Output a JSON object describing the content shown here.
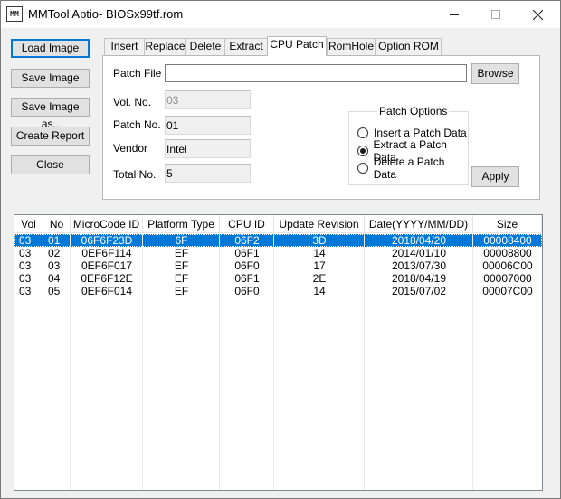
{
  "window": {
    "title": "MMTool Aptio- BIOSx99tf.rom",
    "icon_text": "MM"
  },
  "sidebar": {
    "load_image": "Load Image",
    "save_image": "Save Image",
    "save_image_as": "Save Image as..",
    "create_report": "Create Report",
    "close": "Close"
  },
  "tabs": [
    "Insert",
    "Replace",
    "Delete",
    "Extract",
    "CPU Patch",
    "RomHole",
    "Option ROM"
  ],
  "active_tab": "CPU Patch",
  "panel": {
    "patch_file_label": "Patch File",
    "patch_file_value": "",
    "browse": "Browse",
    "vol_no_label": "Vol. No.",
    "vol_no_value": "03",
    "patch_no_label": "Patch No.",
    "patch_no_value": "01",
    "vendor_label": "Vendor",
    "vendor_value": "Intel",
    "total_no_label": "Total No.",
    "total_no_value": "5",
    "patch_options_title": "Patch Options",
    "options": [
      {
        "label": "Insert a Patch Data",
        "selected": false
      },
      {
        "label": "Extract a Patch Data",
        "selected": true
      },
      {
        "label": "Delete a Patch Data",
        "selected": false
      }
    ],
    "apply": "Apply"
  },
  "table": {
    "columns": [
      "Vol",
      "No",
      "MicroCode ID",
      "Platform Type",
      "CPU ID",
      "Update Revision",
      "Date(YYYY/MM/DD)",
      "Size"
    ],
    "rows": [
      [
        "03",
        "01",
        "06F6F23D",
        "6F",
        "06F2",
        "3D",
        "2018/04/20",
        "00008400"
      ],
      [
        "03",
        "02",
        "0EF6F114",
        "EF",
        "06F1",
        "14",
        "2014/01/10",
        "00008800"
      ],
      [
        "03",
        "03",
        "0EF6F017",
        "EF",
        "06F0",
        "17",
        "2013/07/30",
        "00006C00"
      ],
      [
        "03",
        "04",
        "0EF6F12E",
        "EF",
        "06F1",
        "2E",
        "2018/04/19",
        "00007000"
      ],
      [
        "03",
        "05",
        "0EF6F014",
        "EF",
        "06F0",
        "14",
        "2015/07/02",
        "00007C00"
      ]
    ],
    "selected_row": 0,
    "selection_color": "#0078d7"
  }
}
